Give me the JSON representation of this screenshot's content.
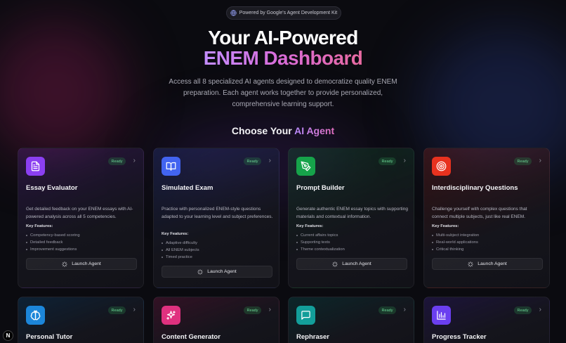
{
  "header": {
    "badge_text": "Powered by Google's Agent Development Kit",
    "title_line1": "Your AI-Powered",
    "title_line2": "ENEM Dashboard",
    "subtitle": "Access all 8 specialized AI agents designed to democratize quality ENEM preparation. Each agent works together to provide personalized, comprehensive learning support."
  },
  "section": {
    "title_prefix": "Choose Your",
    "title_accent": "AI Agent"
  },
  "common": {
    "ready_label": "Ready",
    "key_features_label": "Key Features:",
    "launch_label": "Launch Agent"
  },
  "agents": [
    {
      "name": "Essay Evaluator",
      "icon": "document-icon",
      "color": "#8b3ff0",
      "description": "Get detailed feedback on your ENEM essays with AI-powered analysis across all 5 competencies.",
      "features": [
        "Competency-based scoring",
        "Detailed feedback",
        "Improvement suggestions"
      ]
    },
    {
      "name": "Simulated Exam",
      "icon": "book-open-icon",
      "color": "#4264f0",
      "description": "Practice with personalized ENEM-style questions adapted to your learning level and subject preferences.",
      "features": [
        "Adaptive difficulty",
        "All ENEM subjects",
        "Timed practice"
      ]
    },
    {
      "name": "Prompt Builder",
      "icon": "pen-tool-icon",
      "color": "#16a34a",
      "description": "Generate authentic ENEM essay topics with supporting materials and contextual information.",
      "features": [
        "Current affairs topics",
        "Supporting texts",
        "Theme contextualization"
      ]
    },
    {
      "name": "Interdisciplinary Questions",
      "icon": "target-icon",
      "color": "#e8321f",
      "description": "Challenge yourself with complex questions that connect multiple subjects, just like real ENEM.",
      "features": [
        "Multi-subject integration",
        "Real-world applications",
        "Critical thinking"
      ]
    },
    {
      "name": "Personal Tutor",
      "icon": "brain-icon",
      "color": "#1c86d9"
    },
    {
      "name": "Content Generator",
      "icon": "sparkles-icon",
      "color": "#e0317f"
    },
    {
      "name": "Rephraser",
      "icon": "message-square-icon",
      "color": "#139e9a"
    },
    {
      "name": "Progress Tracker",
      "icon": "bar-chart-icon",
      "color": "#6b3ff0"
    }
  ],
  "footer": {
    "next_badge": "N"
  }
}
